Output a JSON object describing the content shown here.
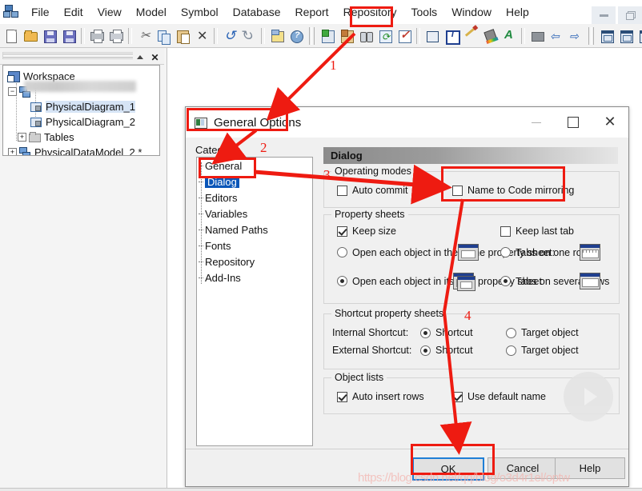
{
  "app": {
    "icon": "pdm-app-icon",
    "menu": [
      "File",
      "Edit",
      "View",
      "Model",
      "Symbol",
      "Database",
      "Report",
      "Repository",
      "Tools",
      "Window",
      "Help"
    ],
    "highlighted_menu": "Tools",
    "window_buttons": [
      "minimize",
      "restore"
    ]
  },
  "toolbar": {
    "groups": [
      [
        "new-icon",
        "open-folder-icon",
        "save-icon",
        "save-all-icon"
      ],
      [
        "print-preview-icon",
        "print-icon"
      ],
      [
        "cut-icon",
        "copy-icon",
        "paste-icon",
        "delete-icon"
      ],
      [
        "undo-icon",
        "redo-icon"
      ],
      [
        "report-icon",
        "help-globe-icon"
      ],
      [
        "new-model-icon",
        "new-package-icon",
        "find-icon",
        "refresh-icon",
        "check-model-icon"
      ],
      [
        "symbol-icon",
        "text-symbol-icon",
        "pencil-icon",
        "fill-color-icon",
        "font-color-icon"
      ],
      [
        "gray-block-icon",
        "prev-icon",
        "next-icon"
      ],
      [
        "diagram1-icon",
        "diagram2-icon",
        "list1-icon",
        "list2-icon"
      ]
    ]
  },
  "browser_panel": {
    "title_grip": "panel-grip",
    "buttons": [
      "collapse",
      "close"
    ],
    "tree": [
      {
        "label": "Workspace",
        "indent": 0,
        "icon": "workspace-icon",
        "expander": "none",
        "blurred": false
      },
      {
        "label": "",
        "indent": 1,
        "icon": "model-icon",
        "expander": "minus",
        "blurred": true
      },
      {
        "label": "PhysicalDiagram_1",
        "indent": 2,
        "icon": "diagram-icon",
        "expander": "none",
        "selected": true
      },
      {
        "label": "PhysicalDiagram_2",
        "indent": 2,
        "icon": "diagram-icon",
        "expander": "none",
        "selected": false
      },
      {
        "label": "Tables",
        "indent": 2,
        "icon": "folder-icon",
        "expander": "plus",
        "selected": false
      },
      {
        "label": "PhysicalDataModel_2 *",
        "indent": 1,
        "icon": "model-icon",
        "expander": "plus",
        "selected": false
      }
    ]
  },
  "dialog": {
    "title": "General Options",
    "icon": "general-options-icon",
    "window_buttons": {
      "minimize": "–",
      "maximize": "□",
      "close": "✕"
    },
    "category_label": "Category:",
    "categories": [
      {
        "label": "General",
        "selected": false
      },
      {
        "label": "Dialog",
        "selected": true
      },
      {
        "label": "Editors",
        "selected": false
      },
      {
        "label": "Variables",
        "selected": false
      },
      {
        "label": "Named Paths",
        "selected": false
      },
      {
        "label": "Fonts",
        "selected": false
      },
      {
        "label": "Repository",
        "selected": false
      },
      {
        "label": "Add-Ins",
        "selected": false
      }
    ],
    "panel_header": "Dialog",
    "groups": {
      "operating_modes": {
        "legend": "Operating modes",
        "items": [
          {
            "label": "Auto commit",
            "type": "checkbox",
            "checked": false,
            "occluded": true
          },
          {
            "label": "Name to Code mirroring",
            "type": "checkbox",
            "checked": false,
            "highlighted": true
          }
        ]
      },
      "property_sheets": {
        "legend": "Property sheets",
        "checkboxes": [
          {
            "label": "Keep size",
            "checked": true
          },
          {
            "label": "Keep last tab",
            "checked": false
          }
        ],
        "radios_left": [
          {
            "label": "Open each object in the same property sheet:",
            "checked": false,
            "preview": "single-window-icon"
          },
          {
            "label": "Open each object in its own property sheet",
            "checked": true,
            "preview": "double-window-icon"
          }
        ],
        "radios_right": [
          {
            "label": "Tabs on one row",
            "checked": false,
            "preview": "tabs-one-row-icon"
          },
          {
            "label": "Tabs on several rows",
            "checked": true,
            "preview": "tabs-several-rows-icon"
          }
        ]
      },
      "shortcut_property_sheets": {
        "legend": "Shortcut property sheets",
        "rows": [
          {
            "label": "Internal Shortcut:",
            "options": [
              {
                "label": "Shortcut",
                "checked": true
              },
              {
                "label": "Target object",
                "checked": false
              }
            ]
          },
          {
            "label": "External Shortcut:",
            "options": [
              {
                "label": "Shortcut",
                "checked": true
              },
              {
                "label": "Target object",
                "checked": false
              }
            ]
          }
        ]
      },
      "object_lists": {
        "legend": "Object lists",
        "items": [
          {
            "label": "Auto insert rows",
            "checked": true
          },
          {
            "label": "Use default name",
            "checked": true
          }
        ]
      }
    },
    "buttons": {
      "ok": "OK",
      "cancel": "Cancel",
      "help": "Help"
    }
  },
  "annotations": {
    "numbers": [
      "1",
      "2",
      "3",
      "4"
    ],
    "color": "#ee1b11",
    "boxes": [
      "tools-menu",
      "dialog-title",
      "dialog-category-item",
      "name-to-code-mirroring",
      "ok-button"
    ]
  },
  "watermark": {
    "text": "https://blog.csdn.net/qq/blog/o3d4r1el/optw"
  }
}
